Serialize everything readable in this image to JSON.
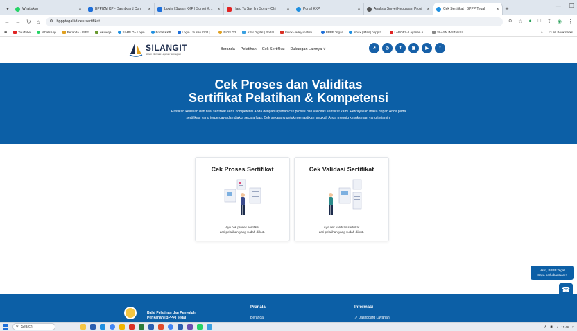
{
  "browser": {
    "tabs": [
      {
        "label": "WhatsApp",
        "color": "#25d366"
      },
      {
        "label": "BPPIZM KP - Dashboard Com",
        "color": "#1e6fd9"
      },
      {
        "label": "Login | Susan KKP | Survei Kep",
        "color": "#1e6fd9"
      },
      {
        "label": "Hard To Say I'm Sorry - Chi",
        "color": "#e02424"
      },
      {
        "label": "Portal KKP",
        "color": "#1e8fe0"
      },
      {
        "label": "Analisis Survei Kepuasan Prosi",
        "color": "#555555"
      },
      {
        "label": "Cek Sertifikat | BPPP Tegal",
        "color": "#1e8fe0"
      }
    ],
    "url": "bppptegal.id/cek-sertifikat",
    "bookmarks": [
      {
        "label": "YouTube",
        "color": "#e02424"
      },
      {
        "label": "WhatsApp",
        "color": "#25d366"
      },
      {
        "label": "Beranda - GIFF",
        "color": "#e0a020"
      },
      {
        "label": "eKinerja",
        "color": "#6a9a30"
      },
      {
        "label": "SIMBLO - Login",
        "color": "#1e8fe0"
      },
      {
        "label": "Portal KKP",
        "color": "#1e8fe0"
      },
      {
        "label": "Login | Susan KKP |...",
        "color": "#1e6fd9"
      },
      {
        "label": "BIOS G2",
        "color": "#e0a020"
      },
      {
        "label": "ASN Digital | Portal",
        "color": "#3aa0e0"
      },
      {
        "label": "Inbox - adeyunafish...",
        "color": "#d93025"
      },
      {
        "label": "BPPP Tegal",
        "color": "#1e6fd9"
      },
      {
        "label": "Inbox | Mail | bppp.t...",
        "color": "#1e8fe0"
      },
      {
        "label": "LAPOR! - Layanan A...",
        "color": "#e02424"
      },
      {
        "label": "SI-ASN INSTANSI",
        "color": "#888888"
      }
    ],
    "all_bookmarks": "All Bookmarks"
  },
  "site": {
    "logo_title": "SILANGIT",
    "logo_sub": "Sistem Informasi Layanan Terintegrasi",
    "menu": [
      "Beranda",
      "Pelatihan",
      "Cek Sertifikat",
      "Dukungan Lainnya ∨"
    ],
    "social": [
      {
        "icon": "chart-icon",
        "glyph": "↗"
      },
      {
        "icon": "globe-icon",
        "glyph": "◎"
      },
      {
        "icon": "facebook-icon",
        "glyph": "f"
      },
      {
        "icon": "instagram-icon",
        "glyph": "▣"
      },
      {
        "icon": "youtube-icon",
        "glyph": "▶"
      },
      {
        "icon": "twitter-icon",
        "glyph": "t"
      }
    ]
  },
  "hero": {
    "title_line1": "Cek Proses dan Validitas",
    "title_line2": "Sertifikat Pelatihan & Kompetensi",
    "paragraph": "Pastikan keaslian dan nilai sertifikat serta kompetensi Anda dengan layanan cek proses dan validitas sertifikat kami. Percayakan masa depan Anda pada sertifikasi yang terpercaya dan diakui secara luas. Cek sekarang untuk memastikan langkah Anda menuju kesuksesan yang terjamin!"
  },
  "cards": [
    {
      "title": "Cek Proses Sertifikat",
      "desc1": "Ayo cek proses sertifikat",
      "desc2": "dari pelatihan yang sudah diikuti."
    },
    {
      "title": "Cek Validasi Sertifikat",
      "desc1": "Ayo cek validitas sertifikat",
      "desc2": "dari pelatihan yang sudah diikuti."
    }
  ],
  "chat": {
    "line1": "Hallo, BPPP Tegal",
    "line2": "Saya perlu bantuan !"
  },
  "footer": {
    "org_line1": "Balai Pelatihan dan Penyuluh",
    "org_line2": "Perikanan (BPPP) Tegal",
    "col1_heading": "Pranala",
    "col1_link": "Beranda",
    "col2_heading": "Informasi",
    "col2_link": "Dashboard Layanan"
  },
  "taskbar": {
    "search": "Search",
    "time": "11:46"
  },
  "colors": {
    "brand_blue": "#0c5fa6",
    "logo_navy": "#1d2c4c"
  }
}
